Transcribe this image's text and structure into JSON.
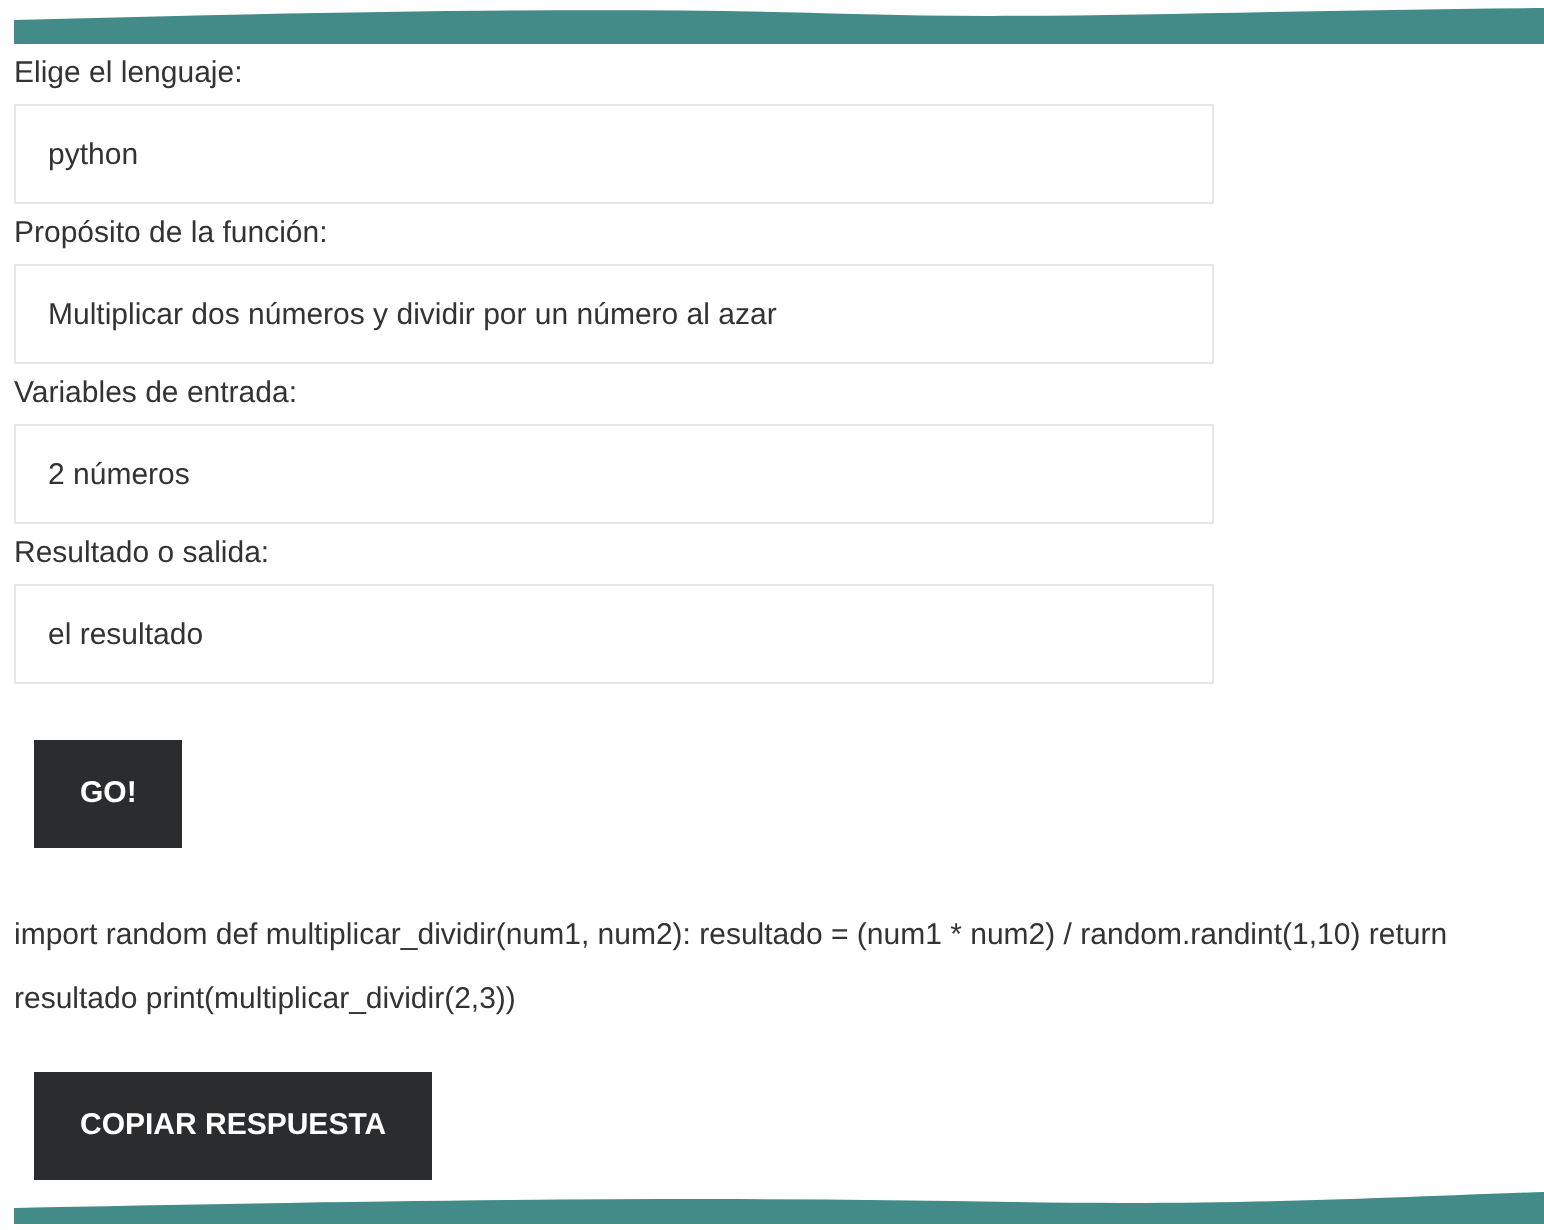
{
  "fields": [
    {
      "label": "Elige el lenguaje:",
      "value": "python"
    },
    {
      "label": "Propósito de la función:",
      "value": "Multiplicar dos números y dividir por un número al azar"
    },
    {
      "label": "Variables de entrada:",
      "value": "2 números"
    },
    {
      "label": "Resultado o salida:",
      "value": "el resultado"
    }
  ],
  "submit_button": "GO!",
  "output": "import random def multiplicar_dividir(num1, num2): resultado = (num1 * num2) / random.randint(1,10) return resultado print(multiplicar_dividir(2,3))",
  "copy_button": "COPIAR RESPUESTA"
}
